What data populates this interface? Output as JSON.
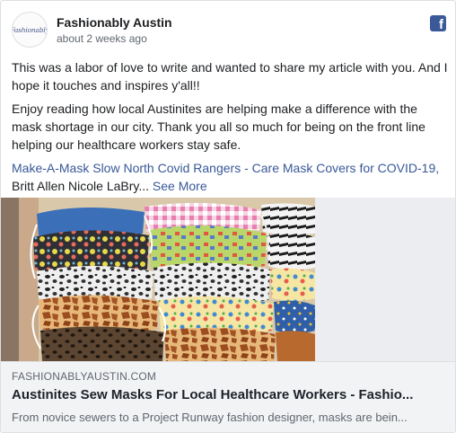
{
  "post": {
    "page_name": "Fashionably Austin",
    "avatar_text": "Fashionably",
    "timestamp": "about 2 weeks ago",
    "paragraph_1": "This was a labor of love to write and wanted to share my article with you. And I hope it touches and inspires y'all!!",
    "paragraph_2": "Enjoy reading how local Austinites are helping make a difference with the mask shortage in our city. Thank you all so much for being on the front line helping our healthcare workers stay safe.",
    "tags_text": "Make-A-Mask Slow North Covid Rangers - Care Mask Covers for COVID-19,",
    "tags_text_2": "Britt Allen Nicole LaBry...",
    "see_more": "See More"
  },
  "icons": {
    "facebook": "facebook-icon",
    "facebook_glyph": "f"
  },
  "link_preview": {
    "domain": "FASHIONABLYAUSTIN.COM",
    "title": "Austinites Sew Masks For Local Healthcare Workers - Fashio...",
    "description": "From novice sewers to a Project Runway fashion designer, masks are bein..."
  },
  "colors": {
    "link": "#385898",
    "facebook_blue": "#3b5998",
    "preview_bg": "#f2f3f5"
  }
}
